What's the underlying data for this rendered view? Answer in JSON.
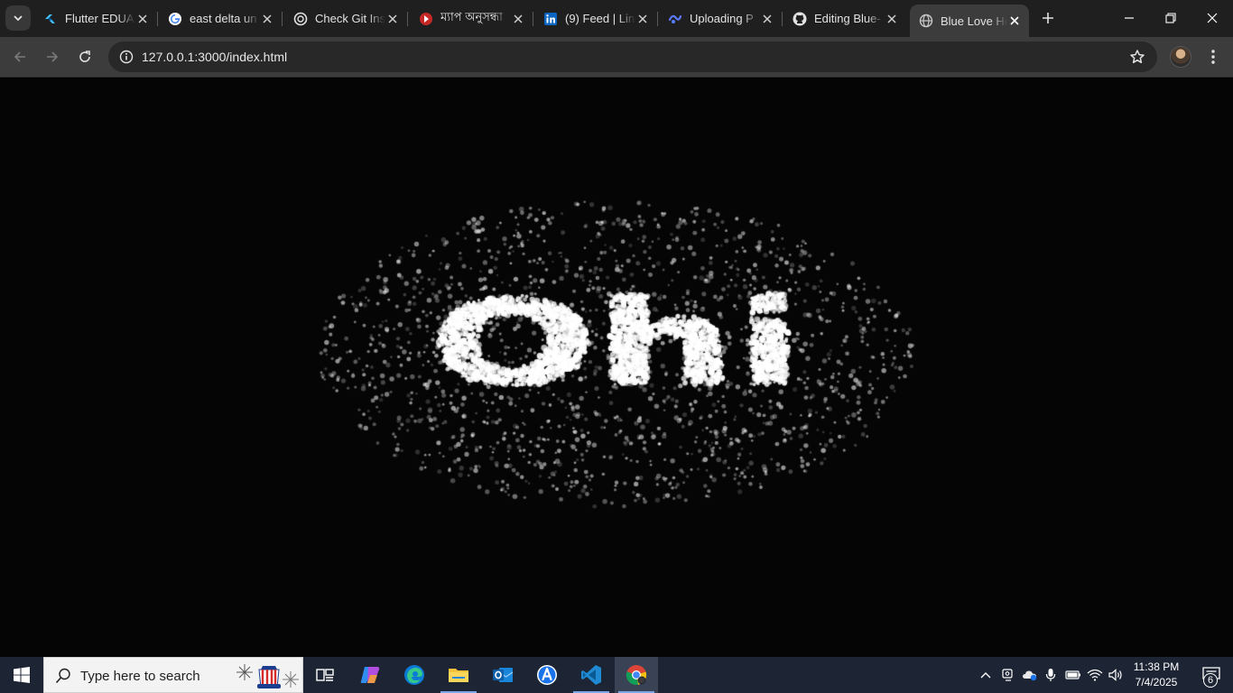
{
  "browser": {
    "tabs": [
      {
        "title": "Flutter EDUA",
        "favicon": "flutter-icon",
        "active": false
      },
      {
        "title": "east delta un",
        "favicon": "google-icon",
        "active": false
      },
      {
        "title": "Check Git Ins",
        "favicon": "openai-icon",
        "active": false
      },
      {
        "title": "ম্যাপ অনুসন্ধা",
        "favicon": "map-app-icon",
        "active": false
      },
      {
        "title": "(9) Feed | Lin",
        "favicon": "linkedin-icon",
        "active": false
      },
      {
        "title": "Uploading P",
        "favicon": "uploader-icon",
        "active": false
      },
      {
        "title": "Editing Blue-",
        "favicon": "github-icon",
        "active": false
      },
      {
        "title": "Blue Love He",
        "favicon": "globe-icon",
        "active": true
      }
    ],
    "address": "127.0.0.1:3000/index.html"
  },
  "page": {
    "text_formed_by_particles": "Ohi",
    "particle_color": "#ffffff",
    "background_color": "#050505"
  },
  "taskbar": {
    "search_placeholder": "Type here to search",
    "apps": [
      "task-view-icon",
      "copilot-icon",
      "edge-icon",
      "file-explorer-icon",
      "outlook-icon",
      "app-store-icon",
      "vscode-icon",
      "chrome-icon"
    ],
    "clock_time": "11:38 PM",
    "clock_date": "7/4/2025",
    "notification_count": "6",
    "accent": "#1d2433"
  }
}
